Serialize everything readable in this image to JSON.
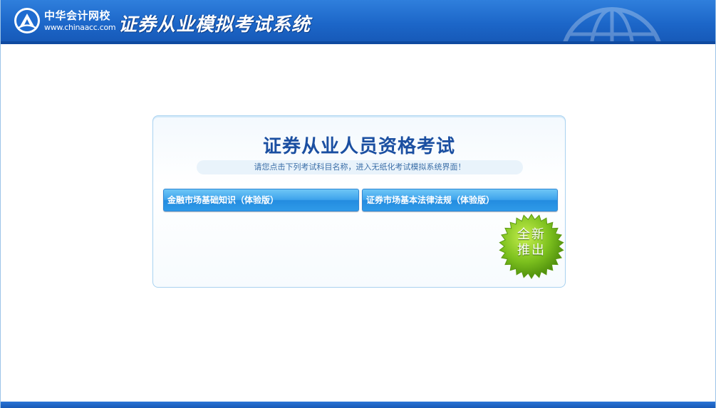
{
  "header": {
    "logo_cn": "中华会计网校",
    "logo_url": "www.chinaacc.com",
    "system_title": "证券从业模拟考试系统"
  },
  "card": {
    "title": "证券从业人员资格考试",
    "hint": "请您点击下列考试科目名称，进入无纸化考试模拟系统界面！",
    "exams": [
      {
        "label": "金融市场基础知识（体验版）"
      },
      {
        "label": "证券市场基本法律法规（体验版）"
      }
    ],
    "badge": {
      "line1": "全新",
      "line2": "推出"
    }
  },
  "colors": {
    "header_blue": "#1c66c8",
    "title_blue": "#1b4fa1",
    "button_blue": "#3ea3ec",
    "badge_green": "#7cc01e"
  }
}
